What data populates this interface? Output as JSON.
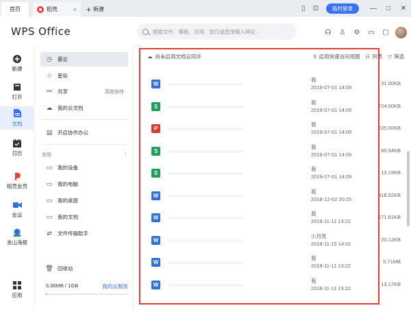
{
  "titlebar": {
    "tabs": [
      {
        "label": "首页"
      },
      {
        "label": "稻壳"
      },
      {
        "label": "新建"
      }
    ],
    "login_label": "临时登录"
  },
  "header": {
    "logo": "WPS Office",
    "search_placeholder": "搜索文件、模板、应用、技巧或直接输入网址..."
  },
  "rail": {
    "items": [
      {
        "label": "新建"
      },
      {
        "label": "打开"
      },
      {
        "label": "文档"
      },
      {
        "label": "日历"
      },
      {
        "label": "稻壳会员"
      },
      {
        "label": "会议"
      },
      {
        "label": "金山海报"
      },
      {
        "label": "应用"
      }
    ]
  },
  "nav2": {
    "items": [
      {
        "label": "最近"
      },
      {
        "label": "星标"
      },
      {
        "label": "共享",
        "extra": "高效协作"
      },
      {
        "label": "我的云文档"
      },
      {
        "label": "开启协作办公"
      }
    ],
    "section_label": "常用",
    "common": [
      {
        "label": "我的设备"
      },
      {
        "label": "我的电脑"
      },
      {
        "label": "我的桌面"
      },
      {
        "label": "我的文档"
      },
      {
        "label": "文件传输助手"
      }
    ],
    "recycle": "回收站",
    "storage": {
      "used": "6.06MB / 1GB",
      "cloud_service": "我的云服务",
      "fill_percent": 0.6
    }
  },
  "main": {
    "sync_notice": "尚未启用文档云同步",
    "quick_view": "启用快速访问视图",
    "list_label": "列表",
    "filter_label": "筛选",
    "files": [
      {
        "type": "w",
        "owner": "我",
        "time": "2019-07-01 14:09",
        "size": "31.50KB"
      },
      {
        "type": "s",
        "owner": "我",
        "time": "2019-07-01 14:09",
        "size": "724.00KB"
      },
      {
        "type": "p",
        "owner": "我",
        "time": "2019-07-01 14:09",
        "size": "225.00KB"
      },
      {
        "type": "s",
        "owner": "我",
        "time": "2019-07-01 14:09",
        "size": "60.54KB"
      },
      {
        "type": "s",
        "owner": "我",
        "time": "2019-07-01 14:09",
        "size": "13.19KB"
      },
      {
        "type": "w",
        "owner": "我",
        "time": "2018-12-02 20:25",
        "size": "318.52KB"
      },
      {
        "type": "w",
        "owner": "我",
        "time": "2018-11-11 13:22",
        "size": "171.81KB"
      },
      {
        "type": "w",
        "owner": "小月亮",
        "time": "2018-11-15 14:01",
        "size": "20.12KB"
      },
      {
        "type": "w",
        "owner": "我",
        "time": "2018-11-11 13:22",
        "size": "5.71MB"
      },
      {
        "type": "w",
        "owner": "我",
        "time": "2018-11-11 13:22",
        "size": "13.17KB"
      }
    ]
  },
  "colors": {
    "accent": "#3a71f2",
    "highlight_border": "#e53935"
  }
}
